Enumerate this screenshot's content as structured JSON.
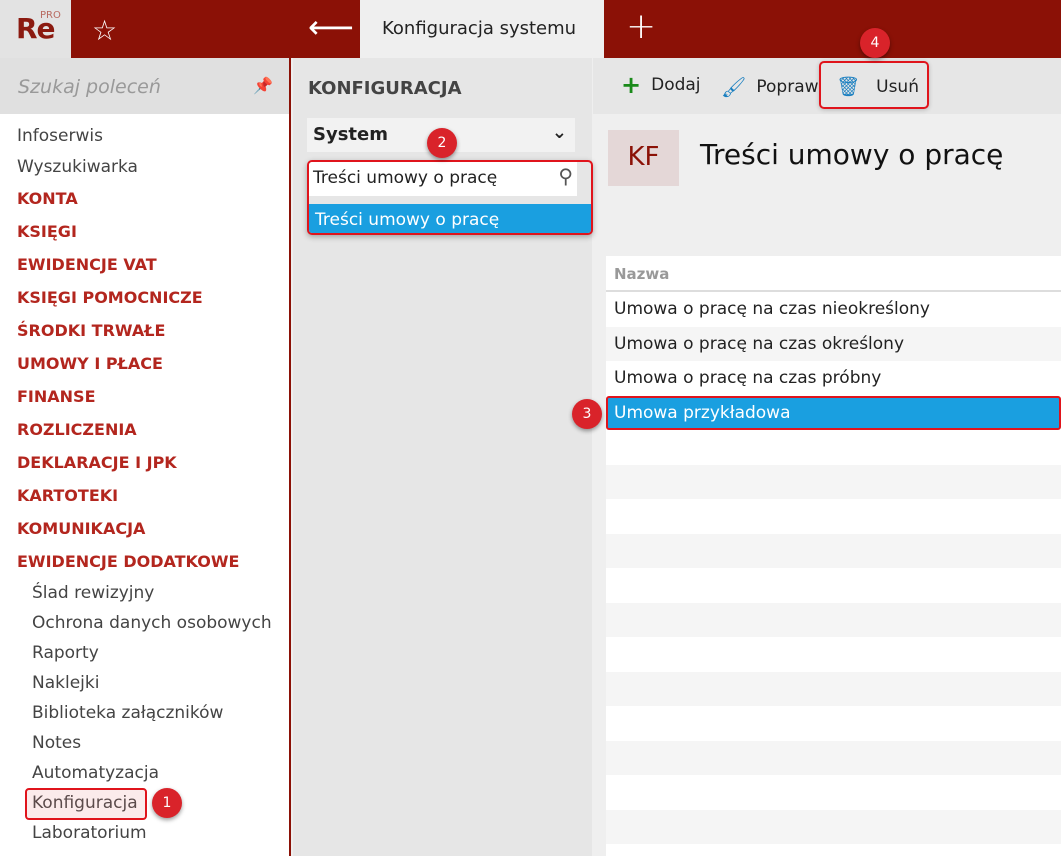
{
  "app": {
    "logo": "Re",
    "logo_sup": "PRO",
    "tab_title": "Konfiguracja systemu"
  },
  "sidebar": {
    "search_placeholder": "Szukaj poleceń",
    "items": [
      "Infoserwis",
      "Wyszukiwarka"
    ],
    "sections": [
      "KONTA",
      "KSIĘGI",
      "EWIDENCJE VAT",
      "KSIĘGI POMOCNICZE",
      "ŚRODKI TRWAŁE",
      "UMOWY I PŁACE",
      "FINANSE",
      "ROZLICZENIA",
      "DEKLARACJE I JPK",
      "KARTOTEKI",
      "KOMUNIKACJA",
      "EWIDENCJE DODATKOWE"
    ],
    "subitems": [
      "Ślad rewizyjny",
      "Ochrona danych osobowych",
      "Raporty",
      "Naklejki",
      "Biblioteka załączników",
      "Notes",
      "Automatyzacja",
      "Konfiguracja",
      "Laboratorium"
    ]
  },
  "middle": {
    "heading": "KONFIGURACJA",
    "select_value": "System",
    "filter_value": "Treści umowy o pracę",
    "result": "Treści umowy o pracę"
  },
  "toolbar": {
    "add": "Dodaj",
    "edit": "Popraw",
    "delete": "Usuń"
  },
  "main": {
    "badge": "KF",
    "title": "Treści umowy o pracę",
    "column": "Nazwa",
    "rows": [
      "Umowa o pracę na czas nieokreślony",
      "Umowa o pracę na czas określony",
      "Umowa o pracę na czas próbny",
      "Umowa przykładowa"
    ]
  },
  "callouts": [
    "1",
    "2",
    "3",
    "4"
  ]
}
